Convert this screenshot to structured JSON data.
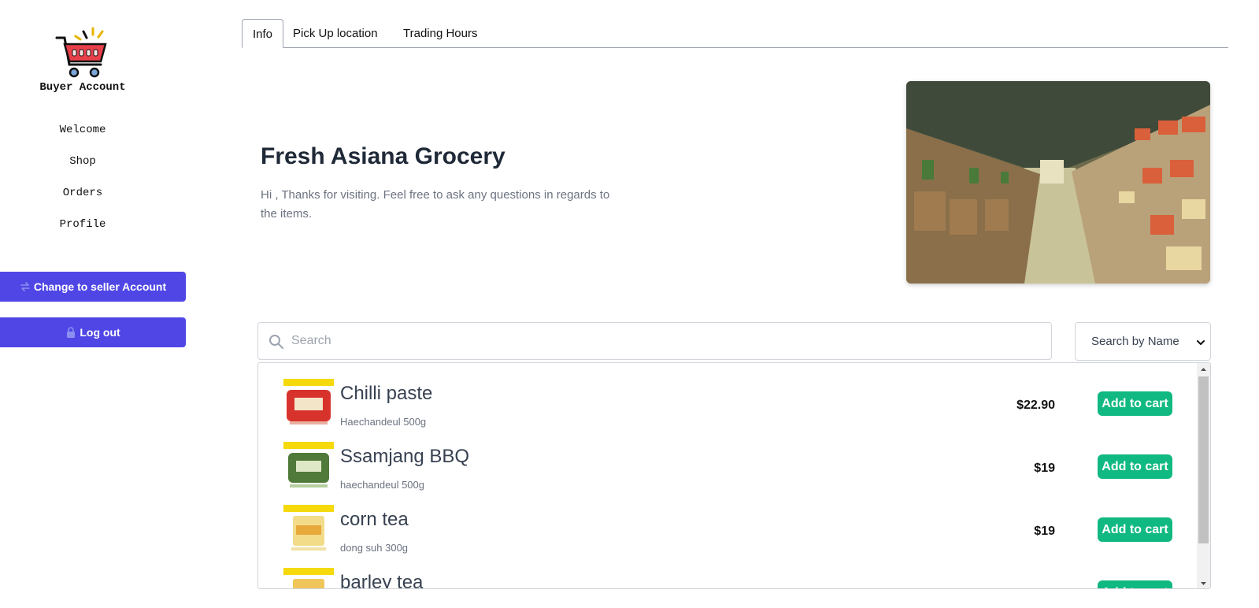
{
  "sidebar": {
    "brand": "Buyer Account",
    "nav": [
      "Welcome",
      "Shop",
      "Orders",
      "Profile"
    ],
    "switch_label": "Change to seller Account",
    "logout_label": "Log out"
  },
  "tabs": [
    "Info",
    "Pick Up location",
    "Trading Hours"
  ],
  "hero": {
    "title": "Fresh Asiana Grocery",
    "description": "Hi , Thanks for visiting. Feel free to ask any questions in regards to the items."
  },
  "search": {
    "placeholder": "Search",
    "filter_selected": "Search by Name"
  },
  "products": [
    {
      "name": "Chilli paste",
      "detail": "Haechandeul 500g",
      "price": "$22.90",
      "button": "Add to cart"
    },
    {
      "name": "Ssamjang BBQ",
      "detail": "haechandeul 500g",
      "price": "$19",
      "button": "Add to cart"
    },
    {
      "name": "corn tea",
      "detail": "dong suh 300g",
      "price": "$19",
      "button": "Add to cart"
    },
    {
      "name": "barley tea",
      "detail": "",
      "price": "",
      "button": "Add to cart"
    }
  ],
  "colors": {
    "primary": "#4f46e5",
    "success": "#10b981"
  }
}
